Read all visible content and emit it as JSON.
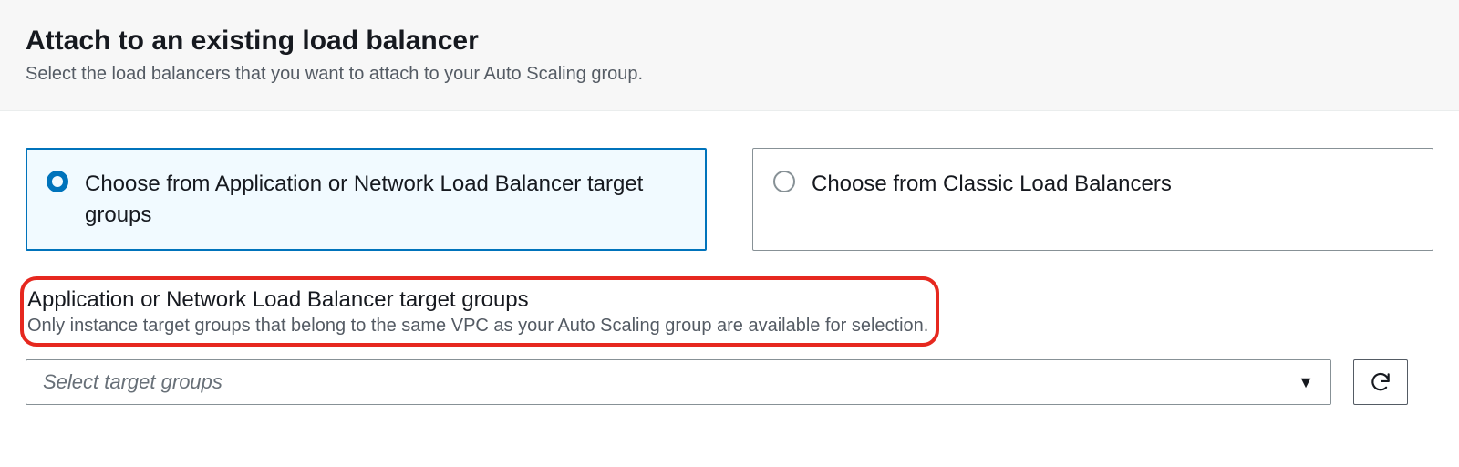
{
  "header": {
    "title": "Attach to an existing load balancer",
    "description": "Select the load balancers that you want to attach to your Auto Scaling group."
  },
  "options": {
    "choice_alb_nlb": "Choose from Application or Network Load Balancer target groups",
    "choice_classic": "Choose from Classic Load Balancers"
  },
  "target_groups": {
    "title": "Application or Network Load Balancer target groups",
    "description": "Only instance target groups that belong to the same VPC as your Auto Scaling group are available for selection.",
    "select_placeholder": "Select target groups"
  }
}
